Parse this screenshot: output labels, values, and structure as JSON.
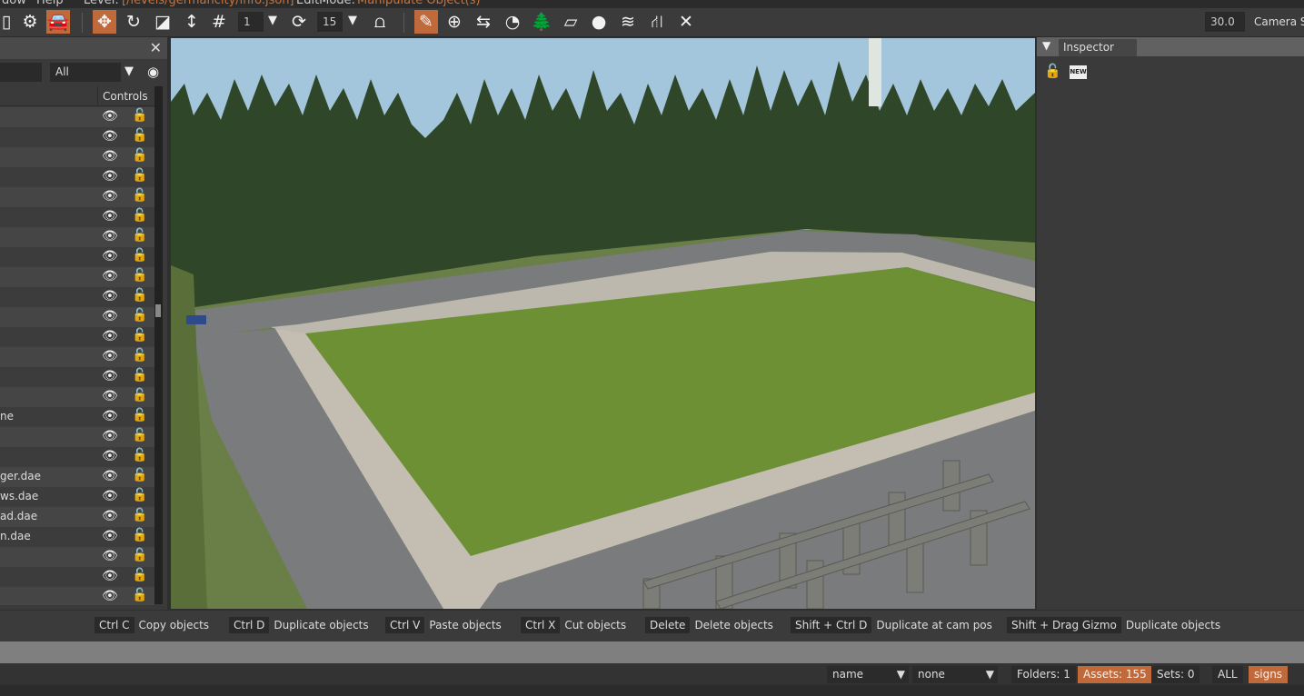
{
  "menubar": {
    "items": [
      "dow",
      "Help"
    ],
    "level_label": "Level:",
    "level_path": "[/levels/germancity/info.json]",
    "editmode_label": "EditMode:",
    "editmode_value": "Manipulate Object(s)"
  },
  "toolbar": {
    "grid_value": "1",
    "rotate_snap_value": "15",
    "camera_speed": "30.0",
    "camera_label": "Camera S"
  },
  "left_panel": {
    "filter_value": "All",
    "controls_header": "Controls",
    "rows": [
      "",
      "",
      "",
      "",
      "",
      "",
      "",
      "",
      "",
      "",
      "",
      "",
      "",
      "",
      "",
      "ne",
      "",
      "",
      "ger.dae",
      "ws.dae",
      "ad.dae",
      "n.dae",
      "",
      "",
      ""
    ]
  },
  "inspector": {
    "title": "Inspector",
    "new_badge": "NEW"
  },
  "shortcuts": [
    {
      "key": "Ctrl C",
      "label": "Copy objects"
    },
    {
      "key": "Ctrl D",
      "label": "Duplicate objects"
    },
    {
      "key": "Ctrl V",
      "label": "Paste objects"
    },
    {
      "key": "Ctrl X",
      "label": "Cut objects"
    },
    {
      "key": "Delete",
      "label": "Delete objects"
    },
    {
      "key": "Shift + Ctrl D",
      "label": "Duplicate at cam pos"
    },
    {
      "key": "Shift + Drag Gizmo",
      "label": "Duplicate objects"
    }
  ],
  "statusbar": {
    "sort_value": "name",
    "group_value": "none",
    "folders": "Folders: 1",
    "assets": "Assets: 155",
    "sets": "Sets: 0",
    "all": "ALL",
    "tag": "signs"
  },
  "colors": {
    "accent": "#c0693a",
    "panel": "#3a3a3a"
  }
}
